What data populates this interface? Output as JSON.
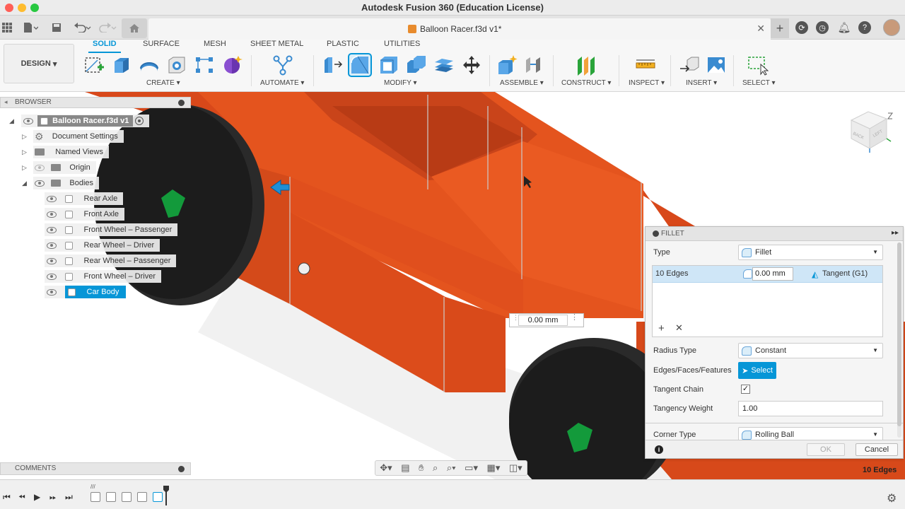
{
  "window": {
    "title": "Autodesk Fusion 360 (Education License)"
  },
  "document_tab": {
    "name": "Balloon Racer.f3d v1*"
  },
  "toolbar": {
    "workspace": "DESIGN",
    "tabs": [
      "SOLID",
      "SURFACE",
      "MESH",
      "SHEET METAL",
      "PLASTIC",
      "UTILITIES"
    ],
    "groups": [
      "CREATE",
      "AUTOMATE",
      "MODIFY",
      "ASSEMBLE",
      "CONSTRUCT",
      "INSPECT",
      "INSERT",
      "SELECT"
    ]
  },
  "browser": {
    "title": "BROWSER",
    "root": "Balloon Racer.f3d v1",
    "items": [
      "Document Settings",
      "Named Views",
      "Origin",
      "Bodies"
    ],
    "bodies": [
      "Rear Axle",
      "Front Axle",
      "Front Wheel – Passenger",
      "Rear Wheel – Driver",
      "Rear Wheel – Passenger",
      "Front Wheel – Driver",
      "Car Body"
    ],
    "selected_body": "Car Body"
  },
  "comments": {
    "title": "COMMENTS"
  },
  "canvas": {
    "dimension_value": "0.00 mm"
  },
  "fillet": {
    "title": "FILLET",
    "type_label": "Type",
    "type_value": "Fillet",
    "edges_label": "10 Edges",
    "radius_value": "0.00 mm",
    "tangent_label": "Tangent (G1)",
    "radius_type_label": "Radius Type",
    "radius_type_value": "Constant",
    "edges_faces_label": "Edges/Faces/Features",
    "select_label": "Select",
    "tangent_chain_label": "Tangent Chain",
    "tangent_chain_checked": true,
    "tangency_weight_label": "Tangency Weight",
    "tangency_weight_value": "1.00",
    "corner_type_label": "Corner Type",
    "corner_type_value": "Rolling Ball",
    "ok_label": "OK",
    "cancel_label": "Cancel"
  },
  "status": {
    "selection": "10 Edges"
  },
  "colors": {
    "accent": "#0696d7",
    "body": "#e4501c",
    "wheel": "#1f1f1f",
    "hub": "#139a3b"
  }
}
